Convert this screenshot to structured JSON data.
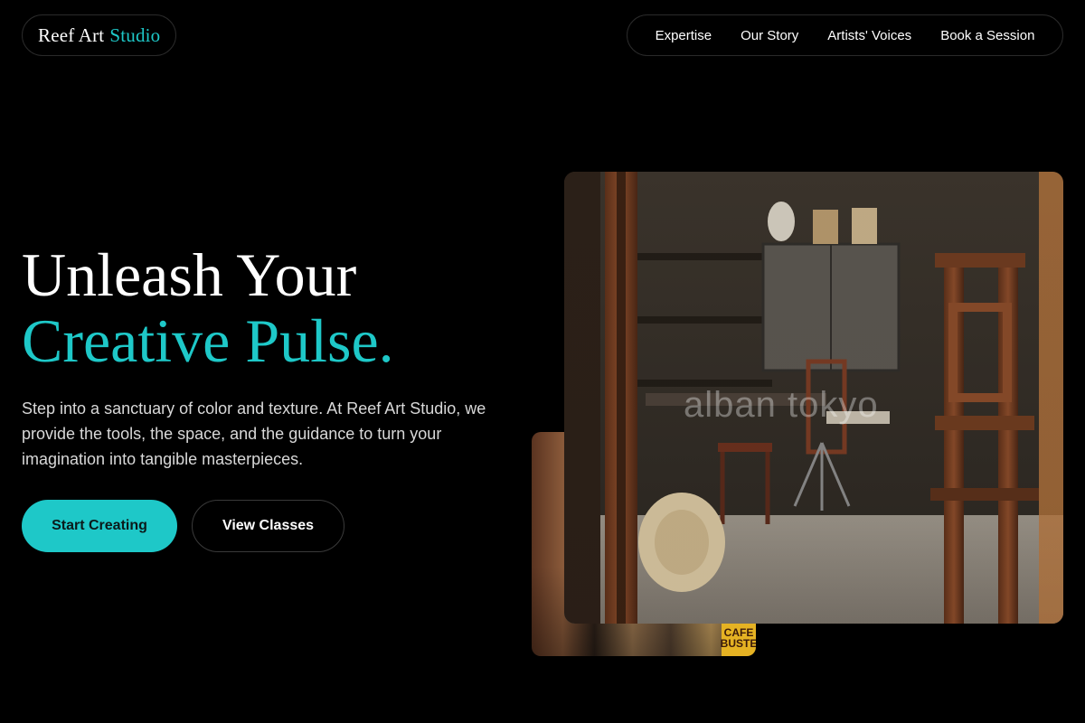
{
  "brand": {
    "name_main": "Reef Art",
    "name_accent": "Studio"
  },
  "nav": {
    "items": [
      "Expertise",
      "Our Story",
      "Artists' Voices",
      "Book a Session"
    ]
  },
  "hero": {
    "headline_line1": "Unleash Your",
    "headline_line2": "Creative Pulse.",
    "lead": "Step into a sanctuary of color and texture. At Reef Art Studio, we provide the tools, the space, and the guidance to turn your imagination into tangible masterpieces.",
    "primary_cta": "Start Creating",
    "secondary_cta": "View Classes"
  },
  "media": {
    "main_image_watermark": "alban tokyo",
    "back_image_can_text_1": "CAFE",
    "back_image_can_text_2": "BUSTE"
  },
  "colors": {
    "background": "#000000",
    "accent": "#1ec8c8",
    "text": "#ffffff",
    "muted_text": "#d8d8d8",
    "border": "#2a2a2a"
  }
}
